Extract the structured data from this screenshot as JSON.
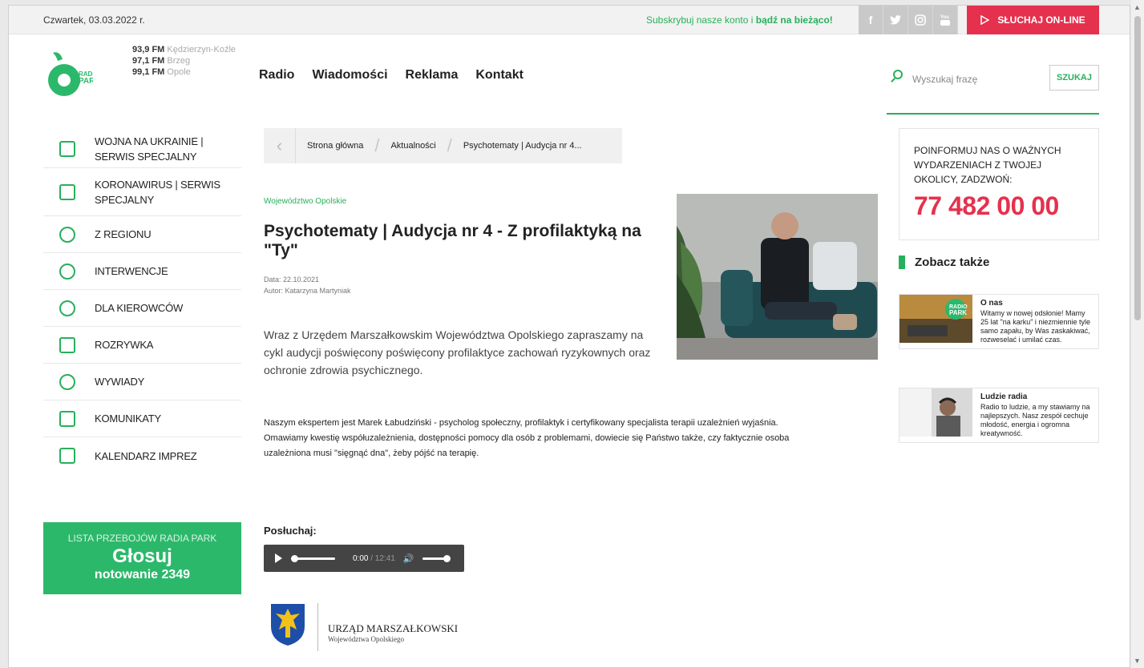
{
  "topbar": {
    "date": "Czwartek, 03.03.2022 r.",
    "promo_prefix": "Subskrybuj nasze konto i ",
    "promo_bold": "bądź na bieżąco!",
    "social": [
      "f",
      "t",
      "ig",
      "yt"
    ],
    "listen_label_bold": "SŁUCHAJ",
    "listen_label_rest": " ON-LINE"
  },
  "header": {
    "logo_text": "RADIO PARK",
    "frequencies": [
      {
        "freq": "93,9 FM",
        "city": "Kędzierzyn-Koźle"
      },
      {
        "freq": "97,1 FM",
        "city": "Brzeg"
      },
      {
        "freq": "99,1 FM",
        "city": "Opole"
      }
    ],
    "nav": [
      "Radio",
      "Wiadomości",
      "Reklama",
      "Kontakt"
    ],
    "search": {
      "placeholder": "Wyszukaj frazę",
      "button": "SZUKAJ"
    }
  },
  "sidebar": {
    "items": [
      {
        "label": "WOJNA NA UKRAINIE | SERWIS SPECJALNY",
        "icon": "building-icon"
      },
      {
        "label": "KORONAWIRUS | SERWIS SPECJALNY",
        "icon": "building-icon"
      },
      {
        "label": "Z REGIONU",
        "icon": "chat-icon"
      },
      {
        "label": "INTERWENCJE",
        "icon": "people-icon"
      },
      {
        "label": "DLA KIEROWCÓW",
        "icon": "car-icon"
      },
      {
        "label": "ROZRYWKA",
        "icon": "sign-icon"
      },
      {
        "label": "WYWIADY",
        "icon": "microphone-icon"
      },
      {
        "label": "KOMUNIKATY",
        "icon": "building-icon"
      },
      {
        "label": "KALENDARZ IMPREZ",
        "icon": "calendar-icon"
      }
    ],
    "vote": {
      "line1": "LISTA PRZEBOJÓW RADIA PARK",
      "line2": "Głosuj",
      "line3": "notowanie 2349"
    }
  },
  "breadcrumb": [
    "Strona główna",
    "Aktualności",
    "Psychotematy | Audycja nr 4..."
  ],
  "article": {
    "region": "Województwo Opolskie",
    "title": "Psychotematy | Audycja nr 4 - Z profilaktyką na \"Ty\"",
    "date": "Data: 22.10.2021",
    "author": "Autor: Katarzyna Martyniak",
    "lead": "Wraz z Urzędem Marszałkowskim Województwa Opolskiego zapraszamy na cykl audycji poświęcony poświęcony profilaktyce zachowań ryzykownych oraz ochronie zdrowia psychicznego.",
    "body": "Naszym ekspertem jest Marek Łabudziński - psycholog społeczny, profilaktyk i certyfikowany specjalista terapii uzależnień wyjaśnia. Omawiamy kwestię współuzależnienia, dostępności pomocy dla osób z problemami, dowiecie się Państwo także, czy faktycznie osoba uzależniona musi \"sięgnąć dna\", żeby pójść na terapię.",
    "listen_label": "Posłuchaj:",
    "player": {
      "current": "0:00",
      "duration": " / 12:41",
      "progress": 0,
      "volume": 1.0
    },
    "sponsor_line1": "URZĄD MARSZAŁKOWSKI",
    "sponsor_line2": "Województwa Opolskiego"
  },
  "right": {
    "info_text": "POINFORMUJ NAS O WAŻNYCH WYDARZENIACH Z TWOJEJ OKOLICY, ZADZWOŃ:",
    "phone": "77 482 00 00",
    "see_also": "Zobacz także",
    "cards": [
      {
        "title": "O nas",
        "desc": "Witamy w nowej odsłonie! Mamy 25 lat \"na karku\" i niezmiennie tyle samo zapału, by Was zaskakiwać, rozweselać i umilać czas."
      },
      {
        "title": "Ludzie radia",
        "desc": "Radio to ludzie, a my stawiamy na najlepszych. Nasz zespół cechuje młodość, energia i ogromna kreatywność."
      }
    ]
  },
  "colors": {
    "accent": "#27b05b",
    "red": "#e5314d",
    "vote_bg": "#2cb86b"
  }
}
